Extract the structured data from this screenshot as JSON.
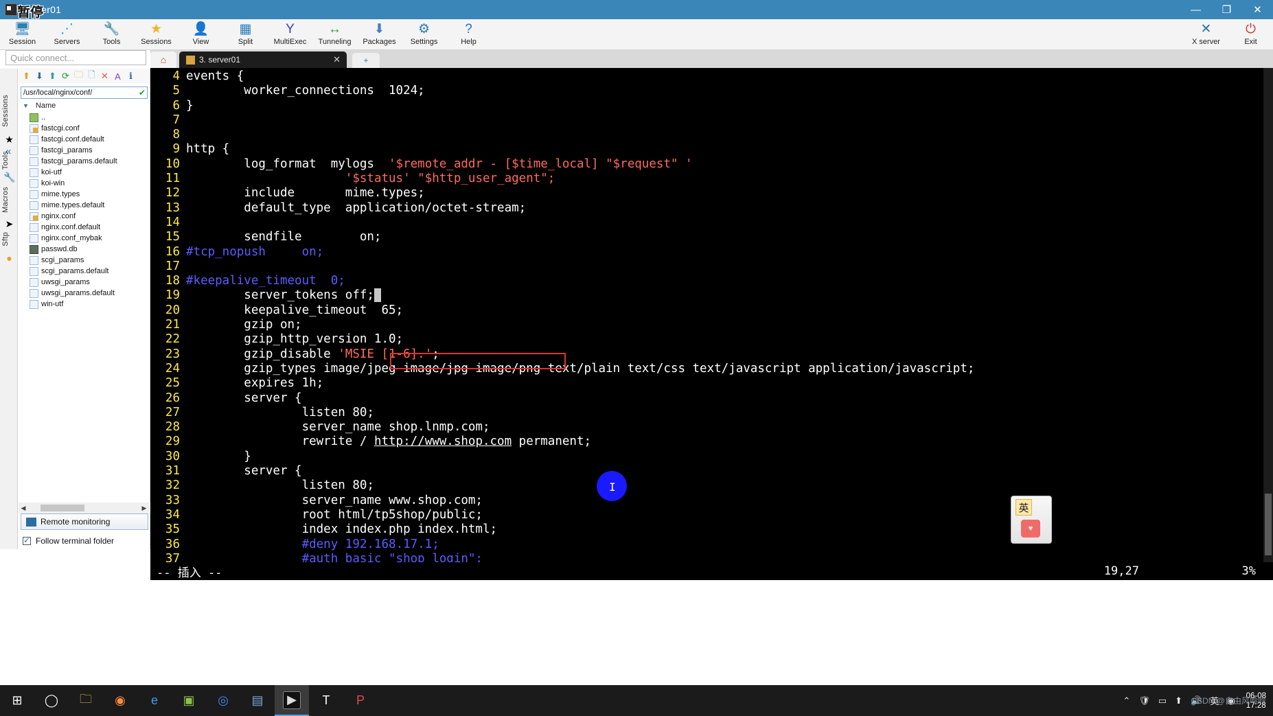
{
  "window": {
    "title": "server01",
    "overlay_badge": "暂停",
    "buttons": {
      "minimize": "—",
      "maximize": "❐",
      "close": "✕"
    }
  },
  "toolbar": {
    "items": [
      {
        "label": "Session",
        "icon": "session-icon",
        "glyph": "🖥"
      },
      {
        "label": "Servers",
        "icon": "servers-icon",
        "glyph": "⋰"
      },
      {
        "label": "Tools",
        "icon": "tools-icon",
        "glyph": "🔧"
      },
      {
        "label": "Sessions",
        "icon": "sessions-icon",
        "glyph": "★"
      },
      {
        "label": "View",
        "icon": "view-icon",
        "glyph": "👤"
      },
      {
        "label": "Split",
        "icon": "split-icon",
        "glyph": "▦"
      },
      {
        "label": "MultiExec",
        "icon": "multiexec-icon",
        "glyph": "Y"
      },
      {
        "label": "Tunneling",
        "icon": "tunneling-icon",
        "glyph": "↔"
      },
      {
        "label": "Packages",
        "icon": "packages-icon",
        "glyph": "⬇"
      },
      {
        "label": "Settings",
        "icon": "settings-icon",
        "glyph": "⚙"
      },
      {
        "label": "Help",
        "icon": "help-icon",
        "glyph": "?"
      }
    ],
    "right_items": [
      {
        "label": "X server",
        "icon": "xserver-icon",
        "glyph": "✕"
      },
      {
        "label": "Exit",
        "icon": "power-icon",
        "glyph": "⏻"
      }
    ]
  },
  "quick_connect": {
    "placeholder": "Quick connect..."
  },
  "vertical_tabs": [
    {
      "label": "Sessions",
      "icon": "star-icon",
      "glyph": "★"
    },
    {
      "label": "Tools",
      "icon": "wrench-icon",
      "glyph": "🔧"
    },
    {
      "label": "Macros",
      "icon": "send-icon",
      "glyph": "➤"
    },
    {
      "label": "Sftp",
      "icon": "globe-icon",
      "glyph": "●"
    }
  ],
  "sftp": {
    "toolbar_icons": [
      "up-folder-icon",
      "download-icon",
      "upload-icon",
      "refresh-icon",
      "new-folder-icon",
      "new-file-icon",
      "delete-icon",
      "font-icon",
      "info-icon"
    ],
    "path": "/usr/local/nginx/conf/",
    "path_status_icon": "check-circle-icon",
    "column_header": "Name",
    "files": [
      {
        "name": "..",
        "type": "up"
      },
      {
        "name": "fastcgi.conf",
        "type": "edit"
      },
      {
        "name": "fastcgi.conf.default",
        "type": "doc"
      },
      {
        "name": "fastcgi_params",
        "type": "doc"
      },
      {
        "name": "fastcgi_params.default",
        "type": "doc"
      },
      {
        "name": "koi-utf",
        "type": "doc"
      },
      {
        "name": "koi-win",
        "type": "doc"
      },
      {
        "name": "mime.types",
        "type": "doc"
      },
      {
        "name": "mime.types.default",
        "type": "doc"
      },
      {
        "name": "nginx.conf",
        "type": "edit"
      },
      {
        "name": "nginx.conf.default",
        "type": "doc"
      },
      {
        "name": "nginx.conf_mybak",
        "type": "doc"
      },
      {
        "name": "passwd.db",
        "type": "db"
      },
      {
        "name": "scgi_params",
        "type": "doc"
      },
      {
        "name": "scgi_params.default",
        "type": "doc"
      },
      {
        "name": "uwsgi_params",
        "type": "doc"
      },
      {
        "name": "uwsgi_params.default",
        "type": "doc"
      },
      {
        "name": "win-utf",
        "type": "doc"
      }
    ],
    "remote_monitoring": "Remote monitoring",
    "follow_terminal_folder": "Follow terminal folder",
    "follow_checked": true
  },
  "tabs": {
    "home_icon": "home-icon",
    "active": {
      "label": "3. server01",
      "icon": "terminal-icon",
      "close": "✕"
    },
    "new_tab": "+"
  },
  "terminal": {
    "lines": [
      {
        "n": "4",
        "segs": [
          {
            "t": "events {",
            "c": "w"
          }
        ]
      },
      {
        "n": "5",
        "segs": [
          {
            "t": "        worker_connections  1024;",
            "c": "w"
          }
        ]
      },
      {
        "n": "6",
        "segs": [
          {
            "t": "}",
            "c": "w"
          }
        ]
      },
      {
        "n": "7",
        "segs": [
          {
            "t": "",
            "c": "w"
          }
        ]
      },
      {
        "n": "8",
        "segs": [
          {
            "t": "",
            "c": "w"
          }
        ]
      },
      {
        "n": "9",
        "segs": [
          {
            "t": "http {",
            "c": "w"
          }
        ]
      },
      {
        "n": "10",
        "segs": [
          {
            "t": "        log_format  mylogs  ",
            "c": "w"
          },
          {
            "t": "'$remote_addr - [$time_local] \"$request\" '",
            "c": "s"
          }
        ]
      },
      {
        "n": "11",
        "segs": [
          {
            "t": "                      ",
            "c": "w"
          },
          {
            "t": "'$status' \"$http_user_agent\";",
            "c": "s"
          }
        ]
      },
      {
        "n": "12",
        "segs": [
          {
            "t": "        include       mime.types;",
            "c": "w"
          }
        ]
      },
      {
        "n": "13",
        "segs": [
          {
            "t": "        default_type  application/octet-stream;",
            "c": "w"
          }
        ]
      },
      {
        "n": "14",
        "segs": [
          {
            "t": "",
            "c": "w"
          }
        ]
      },
      {
        "n": "15",
        "segs": [
          {
            "t": "        sendfile        on;",
            "c": "w"
          }
        ]
      },
      {
        "n": "16",
        "segs": [
          {
            "t": "#tcp_nopush     on;",
            "c": "c"
          }
        ]
      },
      {
        "n": "17",
        "segs": [
          {
            "t": "",
            "c": "w"
          }
        ]
      },
      {
        "n": "18",
        "segs": [
          {
            "t": "#keepalive_timeout  0;",
            "c": "c"
          }
        ]
      },
      {
        "n": "19",
        "segs": [
          {
            "t": "        server_tokens off;",
            "c": "w"
          },
          {
            "t": " ",
            "c": "cur"
          }
        ]
      },
      {
        "n": "20",
        "segs": [
          {
            "t": "        keepalive_timeout  65;",
            "c": "w"
          }
        ]
      },
      {
        "n": "21",
        "segs": [
          {
            "t": "        gzip on;",
            "c": "w"
          }
        ]
      },
      {
        "n": "22",
        "segs": [
          {
            "t": "        gzip_http_version 1.0;",
            "c": "w"
          }
        ]
      },
      {
        "n": "23",
        "segs": [
          {
            "t": "        gzip_disable ",
            "c": "w"
          },
          {
            "t": "'MSIE [1-6].'",
            "c": "s"
          },
          {
            "t": ";",
            "c": "w"
          }
        ]
      },
      {
        "n": "24",
        "segs": [
          {
            "t": "        gzip_types image/jpeg image/jpg image/png text/plain text/css text/javascript application/javascript;",
            "c": "w"
          }
        ]
      },
      {
        "n": "25",
        "segs": [
          {
            "t": "        expires 1h;",
            "c": "w"
          }
        ]
      },
      {
        "n": "26",
        "segs": [
          {
            "t": "        server {",
            "c": "w"
          }
        ]
      },
      {
        "n": "27",
        "segs": [
          {
            "t": "                listen 80;",
            "c": "w"
          }
        ]
      },
      {
        "n": "28",
        "segs": [
          {
            "t": "                server_name shop.lnmp.com;",
            "c": "w"
          }
        ]
      },
      {
        "n": "29",
        "segs": [
          {
            "t": "                rewrite / ",
            "c": "w"
          },
          {
            "t": "http://www.shop.com",
            "c": "u"
          },
          {
            "t": " permanent;",
            "c": "w"
          }
        ]
      },
      {
        "n": "30",
        "segs": [
          {
            "t": "        }",
            "c": "w"
          }
        ]
      },
      {
        "n": "31",
        "segs": [
          {
            "t": "        server {",
            "c": "w"
          }
        ]
      },
      {
        "n": "32",
        "segs": [
          {
            "t": "                listen 80;",
            "c": "w"
          }
        ]
      },
      {
        "n": "33",
        "segs": [
          {
            "t": "                server_name www.shop.com;",
            "c": "w"
          }
        ]
      },
      {
        "n": "34",
        "segs": [
          {
            "t": "                root html/tp5shop/public;",
            "c": "w"
          }
        ]
      },
      {
        "n": "35",
        "segs": [
          {
            "t": "                index index.php index.html;",
            "c": "w"
          }
        ]
      },
      {
        "n": "36",
        "segs": [
          {
            "t": "                #deny 192.168.17.1;",
            "c": "c"
          }
        ]
      },
      {
        "n": "37",
        "segs": [
          {
            "t": "                #auth_basic \"shop login\";",
            "c": "c"
          }
        ]
      }
    ]
  },
  "status_bar": {
    "mode": "-- 插入 --",
    "position": "19,27",
    "percent": "3%"
  },
  "ime_widget": {
    "lang": "英",
    "tray_label": "Heart"
  },
  "taskbar": {
    "items": [
      {
        "name": "start-button",
        "glyph": "⊞",
        "color": "#ffffff"
      },
      {
        "name": "cortana-button",
        "glyph": "◯",
        "color": "#ffffff"
      },
      {
        "name": "file-explorer",
        "glyph": "🗀",
        "color": "#f2c14e"
      },
      {
        "name": "firefox",
        "glyph": "◉",
        "color": "#ff8a3d"
      },
      {
        "name": "edge-browser",
        "glyph": "e",
        "color": "#3aa0e8"
      },
      {
        "name": "photos-app",
        "glyph": "▣",
        "color": "#8bc34a"
      },
      {
        "name": "chrome-browser",
        "glyph": "◎",
        "color": "#4285f4"
      },
      {
        "name": "app-window",
        "glyph": "▤",
        "color": "#7aa7d8"
      },
      {
        "name": "mobaxterm-terminal",
        "glyph": "▶",
        "color": "#dddddd"
      },
      {
        "name": "typora-editor",
        "glyph": "T",
        "color": "#ffffff"
      },
      {
        "name": "pdf-reader",
        "glyph": "P",
        "color": "#e04a4a"
      }
    ],
    "tray": [
      {
        "name": "show-hidden-icons-icon",
        "glyph": "⌃"
      },
      {
        "name": "security-icon",
        "glyph": "🛡"
      },
      {
        "name": "monitor-icon",
        "glyph": "▭"
      },
      {
        "name": "upload-icon",
        "glyph": "⬆"
      },
      {
        "name": "volume-icon",
        "glyph": "🔊"
      },
      {
        "name": "ime-lang-icon",
        "glyph": "英"
      },
      {
        "name": "app-tray-icon",
        "glyph": "◉"
      }
    ],
    "clock": {
      "date": "06-08",
      "time": "17:28"
    },
    "watermark": "CSDN @自由风吟吟"
  }
}
